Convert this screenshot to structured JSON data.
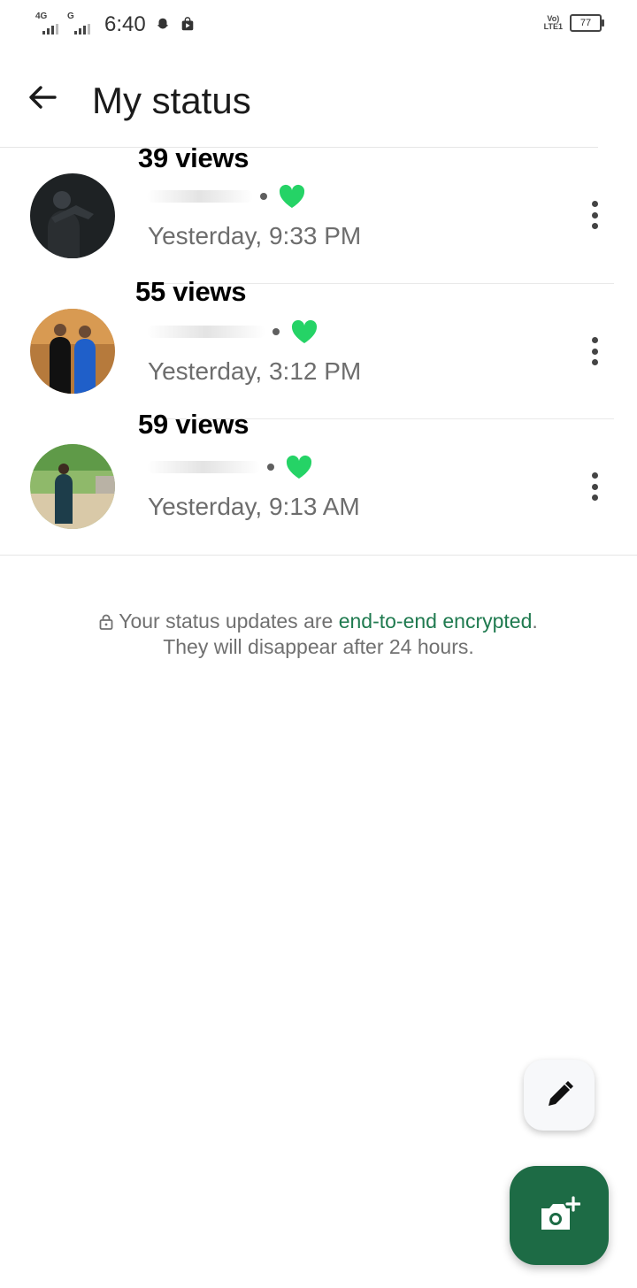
{
  "status_bar": {
    "network1": "4G",
    "network2": "G",
    "time": "6:40",
    "volte_line1": "Vo)",
    "volte_line2": "LTE1",
    "battery": "77"
  },
  "header": {
    "title": "My status"
  },
  "statuses": [
    {
      "views": "39 views",
      "time": "Yesterday, 9:33 PM",
      "liked": true
    },
    {
      "views": "55 views",
      "time": "Yesterday, 3:12 PM",
      "liked": true
    },
    {
      "views": "59 views",
      "time": "Yesterday, 9:13 AM",
      "liked": true
    }
  ],
  "notice": {
    "prefix": "Your status updates are ",
    "link": "end-to-end encrypted",
    "suffix": ".",
    "line2": "They will disappear after 24 hours."
  },
  "colors": {
    "accent_green": "#1d6b45",
    "heart_green": "#25d366",
    "link_green": "#1f7a4f"
  },
  "icons": [
    "back-arrow-icon",
    "more-vert-icon",
    "heart-icon",
    "lock-icon",
    "pencil-icon",
    "add-camera-icon"
  ]
}
